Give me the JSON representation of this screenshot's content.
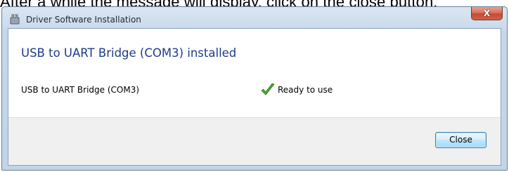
{
  "caption": "After a while the message will display, click on the close button.",
  "window": {
    "title": "Driver Software Installation",
    "close_glyph": "X"
  },
  "content": {
    "heading": "USB to UART Bridge (COM3) installed",
    "device_name": "USB to UART Bridge (COM3)",
    "status": "Ready to use",
    "status_icon": "green-checkmark-icon"
  },
  "footer": {
    "close_label": "Close"
  },
  "colors": {
    "heading": "#1f3c88",
    "check": "#4ca82f",
    "close_button_border": "#3c7fb1",
    "titlebar_close": "#c54a31"
  }
}
